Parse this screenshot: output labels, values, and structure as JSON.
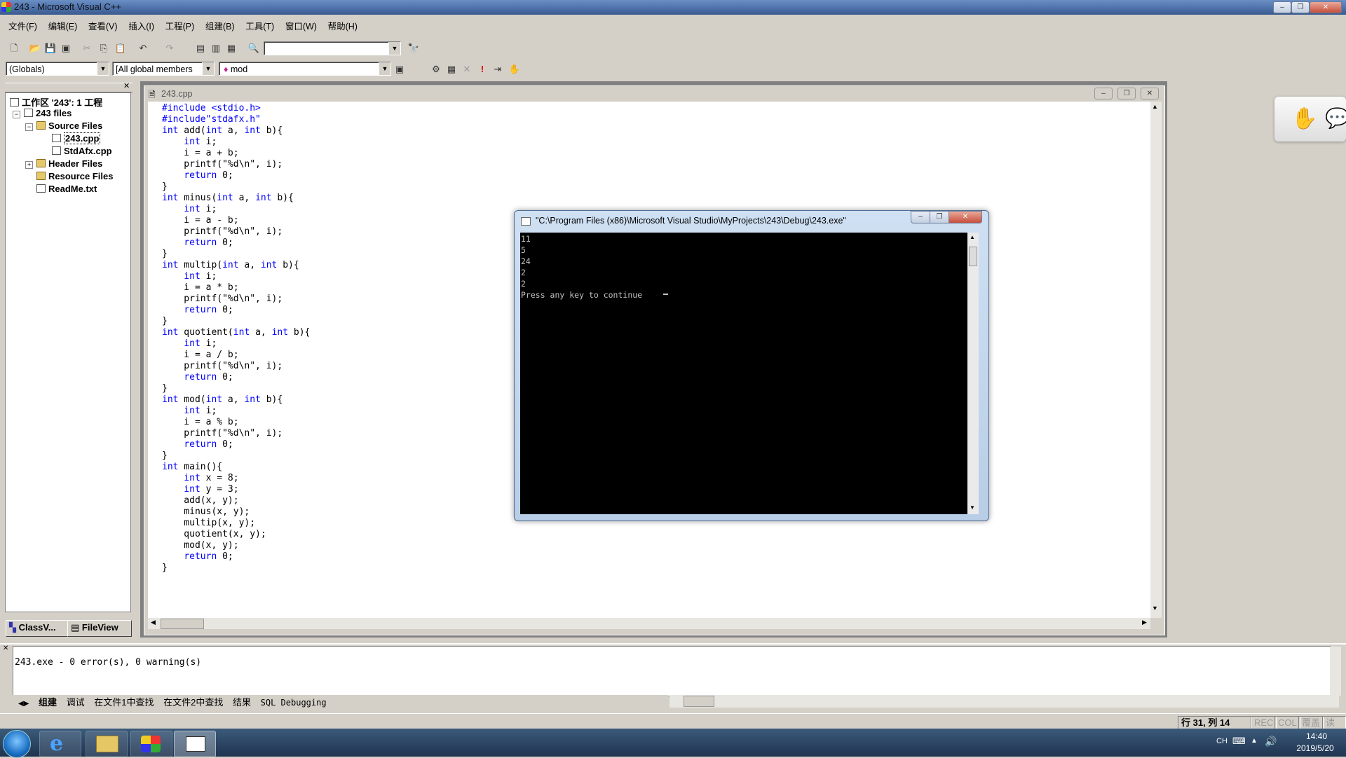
{
  "window": {
    "title": "243 - Microsoft Visual C++"
  },
  "menu": [
    "文件(F)",
    "编辑(E)",
    "查看(V)",
    "插入(I)",
    "工程(P)",
    "组建(B)",
    "工具(T)",
    "窗口(W)",
    "帮助(H)"
  ],
  "toolbar": {
    "scope_combo": "(Globals)",
    "members_combo": "[All global members",
    "function_combo": "mod",
    "find_combo": ""
  },
  "workspace": {
    "title": "工作区 '243': 1 工程",
    "project": "243 files",
    "source_files": "Source Files",
    "files": [
      "243.cpp",
      "StdAfx.cpp"
    ],
    "header_files": "Header Files",
    "resource_files": "Resource Files",
    "readme": "ReadMe.txt",
    "tabs": [
      "ClassV...",
      "FileView"
    ]
  },
  "editor": {
    "title": "243.cpp",
    "code": [
      [
        "#include <stdio.h>",
        ""
      ],
      [
        "#include\"stdafx.h\"",
        ""
      ],
      [
        "int",
        " add(",
        "int",
        " a, ",
        "int",
        " b){"
      ],
      [
        "    ",
        "int",
        " i;"
      ],
      [
        "    i = a + b;"
      ],
      [
        "    printf(\"%d\\n\", i);"
      ],
      [
        "    ",
        "return",
        " 0;"
      ],
      [
        "}"
      ],
      [
        "int",
        " minus(",
        "int",
        " a, ",
        "int",
        " b){"
      ],
      [
        "    ",
        "int",
        " i;"
      ],
      [
        "    i = a - b;"
      ],
      [
        "    printf(\"%d\\n\", i);"
      ],
      [
        "    ",
        "return",
        " 0;"
      ],
      [
        "}"
      ],
      [
        "int",
        " multip(",
        "int",
        " a, ",
        "int",
        " b){"
      ],
      [
        "    ",
        "int",
        " i;"
      ],
      [
        "    i = a * b;"
      ],
      [
        "    printf(\"%d\\n\", i);"
      ],
      [
        "    ",
        "return",
        " 0;"
      ],
      [
        "}"
      ],
      [
        "int",
        " quotient(",
        "int",
        " a, ",
        "int",
        " b){"
      ],
      [
        "    ",
        "int",
        " i;"
      ],
      [
        "    i = a / b;"
      ],
      [
        "    printf(\"%d\\n\", i);"
      ],
      [
        "    ",
        "return",
        " 0;"
      ],
      [
        "}"
      ],
      [
        "int",
        " mod(",
        "int",
        " a, ",
        "int",
        " b){"
      ],
      [
        "    ",
        "int",
        " i;"
      ],
      [
        "    i = a % b;"
      ],
      [
        "    printf(\"%d\\n\", i);"
      ],
      [
        "    ",
        "return",
        " 0;"
      ],
      [
        "}"
      ],
      [
        "int",
        " main(){"
      ],
      [
        "    ",
        "int",
        " x = 8;"
      ],
      [
        "    ",
        "int",
        " y = 3;"
      ],
      [
        "    add(x, y);"
      ],
      [
        "    minus(x, y);"
      ],
      [
        "    multip(x, y);"
      ],
      [
        "    quotient(x, y);"
      ],
      [
        "    mod(x, y);"
      ],
      [
        "    ",
        "return",
        " 0;"
      ],
      [
        "}"
      ]
    ]
  },
  "console": {
    "title": "\"C:\\Program Files (x86)\\Microsoft Visual Studio\\MyProjects\\243\\Debug\\243.exe\"",
    "output": "11\n5\n24\n2\n2\nPress any key to continue"
  },
  "output": {
    "text": "243.exe - 0 error(s), 0 warning(s)",
    "tabs": [
      "组建",
      "调试",
      "在文件1中查找",
      "在文件2中查找",
      "结果",
      "SQL Debugging"
    ]
  },
  "status": {
    "position": "行 31, 列 14",
    "rec": "REC",
    "col": "COL",
    "ovr": "覆盖",
    "read": "读取"
  },
  "taskbar": {
    "ime": "CH",
    "time": "14:40",
    "date": "2019/5/20"
  }
}
